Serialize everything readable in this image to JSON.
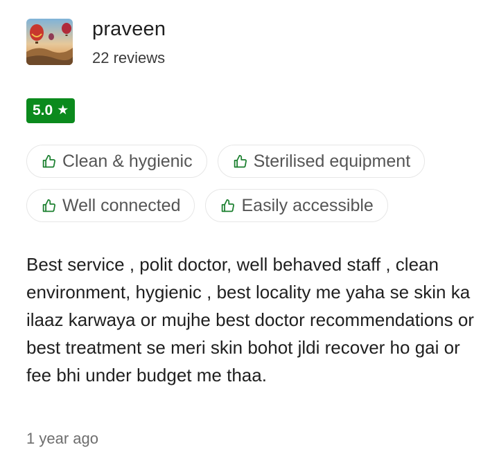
{
  "reviewer": {
    "name": "praveen",
    "review_count": "22 reviews",
    "avatar_icon": "hot-air-balloon-photo"
  },
  "rating": {
    "value": "5.0",
    "star": "★",
    "badge_color": "#0b8a1d"
  },
  "tags": [
    {
      "label": "Clean & hygienic",
      "icon": "thumbs-up-icon"
    },
    {
      "label": "Sterilised equipment",
      "icon": "thumbs-up-icon"
    },
    {
      "label": "Well connected",
      "icon": "thumbs-up-icon"
    },
    {
      "label": "Easily accessible",
      "icon": "thumbs-up-icon"
    }
  ],
  "review": {
    "text": "Best service , polit doctor, well behaved staff , clean environment, hygienic , best locality me yaha se skin ka ilaaz karwaya or mujhe best doctor recommendations or best treatment se meri skin bohot jldi recover ho gai or fee bhi under budget me thaa.",
    "time": "1 year ago"
  },
  "colors": {
    "accent_green": "#0b8a1d",
    "thumb_icon": "#1a7f2e"
  }
}
